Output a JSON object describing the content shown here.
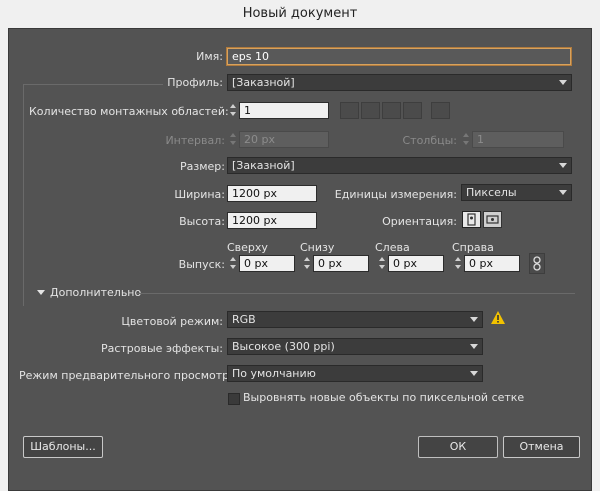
{
  "window": {
    "title": "Новый документ"
  },
  "name": {
    "label": "Имя:",
    "value": "eps 10"
  },
  "profile": {
    "label": "Профиль:",
    "value": "[Заказной]"
  },
  "artboards": {
    "label": "Количество монтажных областей:",
    "value": "1"
  },
  "spacing": {
    "label": "Интервал:",
    "value": "20 px"
  },
  "columns": {
    "label": "Столбцы:",
    "value": "1"
  },
  "size": {
    "label": "Размер:",
    "value": "[Заказной]"
  },
  "width": {
    "label": "Ширина:",
    "value": "1200 px"
  },
  "units": {
    "label": "Единицы измерения:",
    "value": "Пикселы"
  },
  "height": {
    "label": "Высота:",
    "value": "1200 px"
  },
  "orientation": {
    "label": "Ориентация:"
  },
  "bleed": {
    "label": "Выпуск:",
    "top": {
      "label": "Сверху",
      "value": "0 px"
    },
    "bottom": {
      "label": "Снизу",
      "value": "0 px"
    },
    "left": {
      "label": "Слева",
      "value": "0 px"
    },
    "right": {
      "label": "Справа",
      "value": "0 px"
    }
  },
  "advanced": {
    "label": "Дополнительно",
    "color_mode": {
      "label": "Цветовой режим:",
      "value": "RGB"
    },
    "raster_effects": {
      "label": "Растровые эффекты:",
      "value": "Высокое (300 ppi)"
    },
    "preview_mode": {
      "label": "Режим предварительного просмотра:",
      "value": "По умолчанию"
    },
    "align_pixel_grid": {
      "label": "Выровнять новые объекты по пиксельной сетке",
      "checked": false
    }
  },
  "buttons": {
    "templates": "Шаблоны...",
    "ok": "ОК",
    "cancel": "Отмена"
  },
  "colors": {
    "dialog_bg": "#535353",
    "field_bg": "#f0f0f0",
    "focus": "#d7a25e",
    "warning": "#f2c200"
  }
}
